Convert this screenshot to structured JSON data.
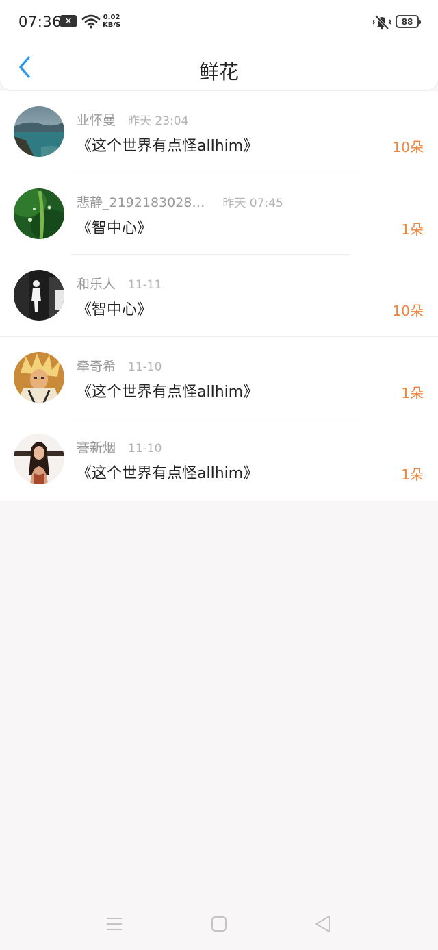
{
  "status_bar": {
    "time": "07:36",
    "notification_icon": "close-box-icon",
    "net_speed_value": "0.02",
    "net_speed_unit": "KB/S",
    "battery_level": "88"
  },
  "header": {
    "title": "鲜花"
  },
  "accent_colors": {
    "back_arrow": "#2c98e8",
    "flower_count": "#f0843c"
  },
  "items": [
    {
      "username": "业怀曼",
      "time": "昨天 23:04",
      "book": "《这个世界有点怪allhim》",
      "count": "10朵"
    },
    {
      "username": "悲静_2192183028…",
      "time": "昨天 07:45",
      "book": "《智中心》",
      "count": "1朵"
    },
    {
      "username": "和乐人",
      "time": "11-11",
      "book": "《智中心》",
      "count": "10朵"
    },
    {
      "username": "牵奇希",
      "time": "11-10",
      "book": "《这个世界有点怪allhim》",
      "count": "1朵"
    },
    {
      "username": "謇新烟",
      "time": "11-10",
      "book": "《这个世界有点怪allhim》",
      "count": "1朵"
    }
  ]
}
